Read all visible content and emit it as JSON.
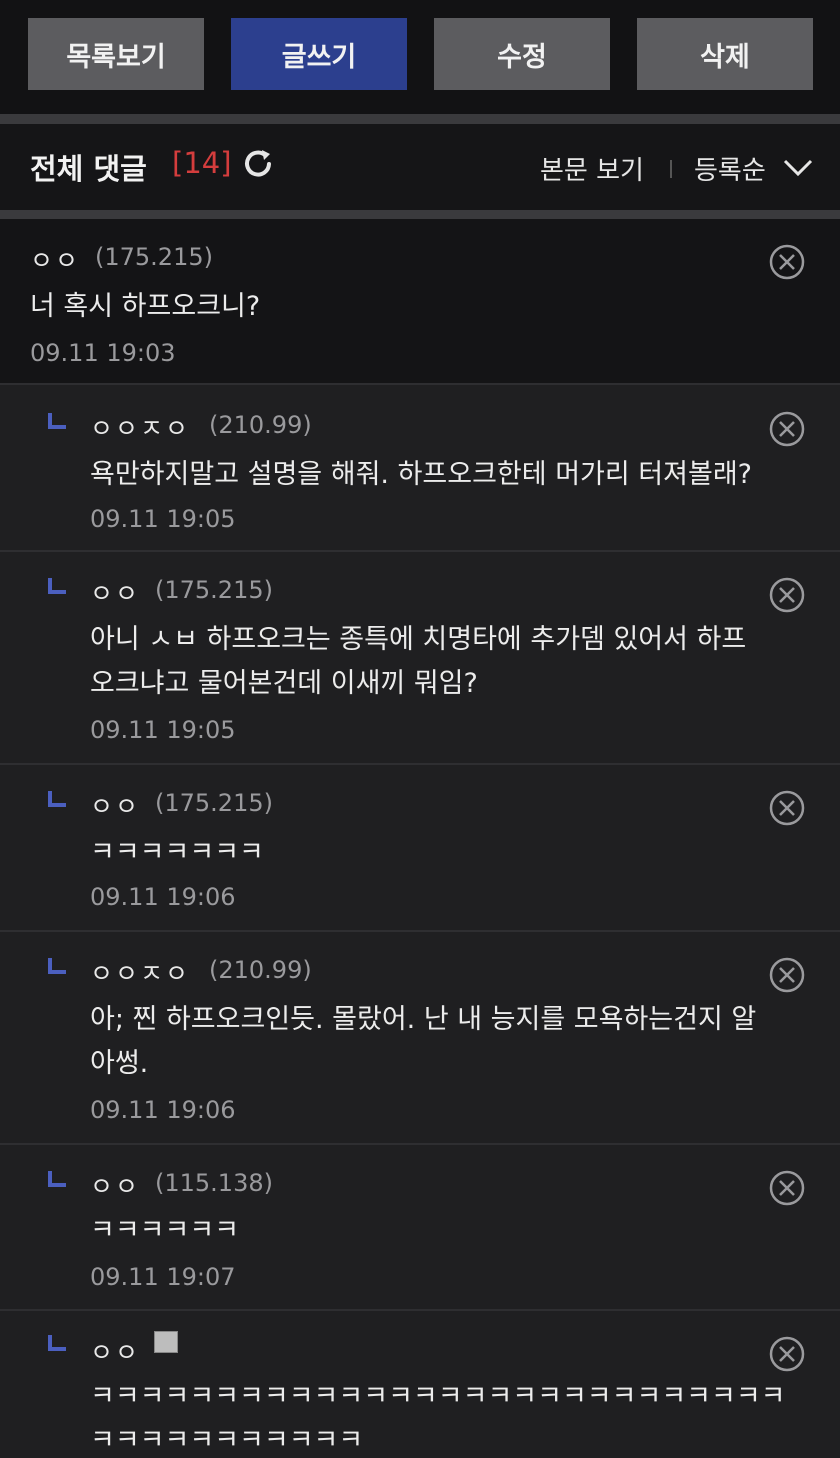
{
  "toolbar": {
    "list_label": "목록보기",
    "write_label": "글쓰기",
    "edit_label": "수정",
    "delete_label": "삭제"
  },
  "comments_header": {
    "title": "전체 댓글",
    "count": "[14]",
    "view_post": "본문 보기",
    "sort": "등록순"
  },
  "comments": [
    {
      "nick": "ㅇㅇ",
      "ip": "(175.215)",
      "body": "너 혹시 하프오크니?",
      "time": "09.11 19:03"
    },
    {
      "nick": "ㅇㅇㅈㅇ",
      "ip": "(210.99)",
      "body": "욕만하지말고 설명을 해줘. 하프오크한테 머가리 터져볼래?",
      "time": "09.11 19:05"
    },
    {
      "nick": "ㅇㅇ",
      "ip": "(175.215)",
      "body": "아니 ㅅㅂ 하프오크는 종특에 치명타에 추가뎀 있어서 하프\n오크냐고 물어본건데 이새끼 뭐임?",
      "time": "09.11 19:05"
    },
    {
      "nick": "ㅇㅇ",
      "ip": "(175.215)",
      "body": "ㅋㅋㅋㅋㅋㅋㅋ",
      "time": "09.11 19:06"
    },
    {
      "nick": "ㅇㅇㅈㅇ",
      "ip": "(210.99)",
      "body": "아; 찐 하프오크인듯. 몰랐어. 난 내 능지를 모욕하는건지 알\n아썽.",
      "time": "09.11 19:06"
    },
    {
      "nick": "ㅇㅇ",
      "ip": "(115.138)",
      "body": "ㅋㅋㅋㅋㅋㅋ",
      "time": "09.11 19:07"
    },
    {
      "nick": "ㅇㅇ",
      "ip": "",
      "body": "ㅋㅋㅋㅋㅋㅋㅋㅋㅋㅋㅋㅋㅋㅋㅋㅋㅋㅋㅋㅋㅋㅋㅋㅋㅋㅋㅋㅋ\nㅋㅋㅋㅋㅋㅋㅋㅋㅋㅋㅋ",
      "time": ""
    }
  ],
  "colors": {
    "accent_blue": "#2c3f8e",
    "count_red": "#d43d3d",
    "reply_marker": "#4b5fbf"
  }
}
